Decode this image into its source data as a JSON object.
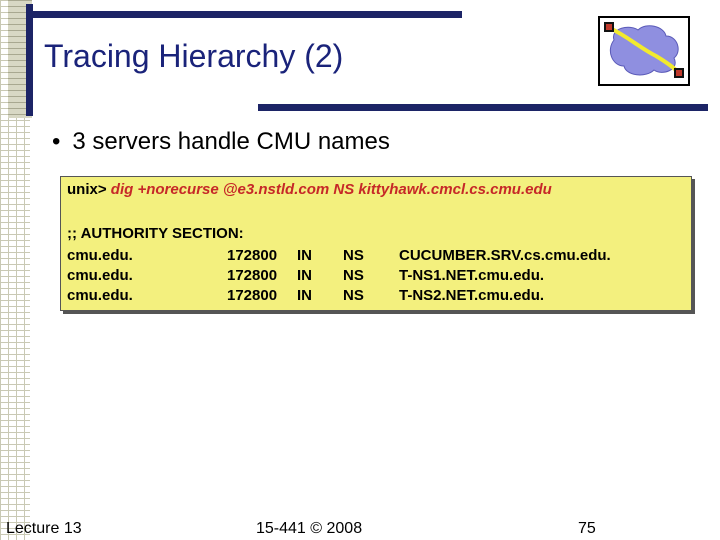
{
  "title": "Tracing Hierarchy (2)",
  "bullet": "3 servers handle CMU names",
  "terminal": {
    "prompt": "unix>",
    "command": "dig +norecurse @e3.nstld.com NS kittyhawk.cmcl.cs.cmu.edu",
    "section_header": ";; AUTHORITY SECTION:",
    "records": [
      {
        "name": "cmu.edu.",
        "ttl": "172800",
        "class": "IN",
        "type": "NS",
        "data": "CUCUMBER.SRV.cs.cmu.edu."
      },
      {
        "name": "cmu.edu.",
        "ttl": "172800",
        "class": "IN",
        "type": "NS",
        "data": "T-NS1.NET.cmu.edu."
      },
      {
        "name": "cmu.edu.",
        "ttl": "172800",
        "class": "IN",
        "type": "NS",
        "data": "T-NS2.NET.cmu.edu."
      }
    ]
  },
  "footer": {
    "left": "Lecture 13",
    "center": "15-441 © 2008",
    "right": "75"
  },
  "colors": {
    "title": "#1a237a",
    "rule": "#1c2466",
    "code_bg": "#f3f07e",
    "command_args": "#c62828"
  }
}
